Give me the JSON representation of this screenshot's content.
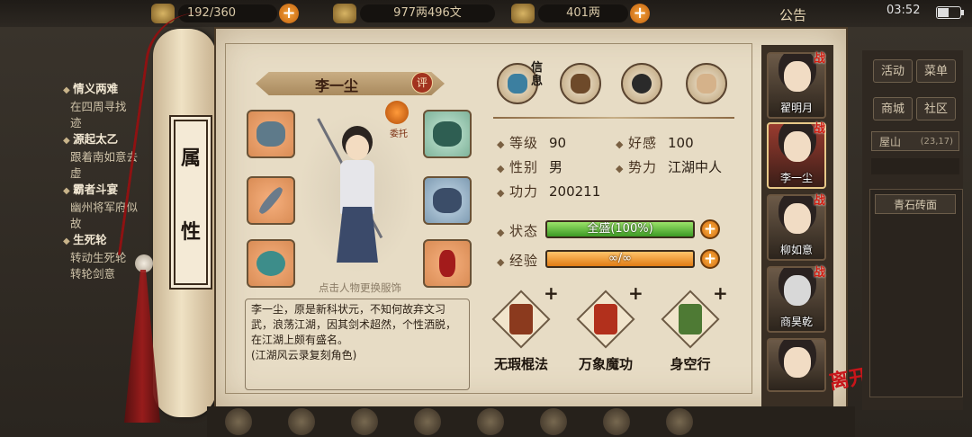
{
  "topbar": {
    "resource1": "192/360",
    "resource2": "977两496文",
    "resource3": "401两",
    "announcement": "公告",
    "time": "03:52"
  },
  "quests": [
    {
      "title": "情义两难",
      "desc": "在四周寻找\n迹"
    },
    {
      "title": "源起太乙",
      "desc": "跟着南如意去\n虚"
    },
    {
      "title": "霸者斗宴",
      "desc": "幽州将军府似\n故"
    },
    {
      "title": "生死轮",
      "desc": "转动生死轮\n转轮剑意"
    }
  ],
  "scroll_title": [
    "属",
    "性"
  ],
  "character": {
    "name": "李一尘",
    "rate_badge": "评",
    "delegate_label": "委托",
    "change_outfit_hint": "点击人物更换服饰",
    "description": "李一尘，原是新科状元，不知何故弃文习武，浪荡江湖，因其剑术超然，个性洒脱，在江湖上颇有盛名。\n(江湖风云录复刻角色)"
  },
  "info_label": "信息",
  "stats": {
    "level_label": "等级",
    "level": "90",
    "affection_label": "好感",
    "affection": "100",
    "gender_label": "性别",
    "gender": "男",
    "faction_label": "势力",
    "faction": "江湖中人",
    "power_label": "功力",
    "power": "200211"
  },
  "status": {
    "label": "状态",
    "text": "全盛(100%)",
    "fill_fraction": 1.0
  },
  "exp": {
    "label": "经验",
    "text": "∞/∞",
    "fill_fraction": 1.0
  },
  "skills": [
    {
      "name": "无瑕棍法"
    },
    {
      "name": "万象魔功"
    },
    {
      "name": "身空行"
    }
  ],
  "party": [
    {
      "name": "翟明月",
      "tag": "战"
    },
    {
      "name": "李一尘",
      "tag": "战"
    },
    {
      "name": "柳如意",
      "tag": "战"
    },
    {
      "name": "商昊乾",
      "tag": "战"
    },
    {
      "name": ""
    }
  ],
  "leave_label": "离开",
  "right_panel": {
    "buttons": [
      "活动",
      "菜单",
      "商城",
      "社区"
    ],
    "location": "屋山",
    "coords": "(23,17)",
    "list_item": "青石砖面"
  },
  "colors": {
    "accent_orange": "#e07c14",
    "accent_green": "#3c9a24",
    "parchment": "#e7dcc5",
    "battle_red": "#d21d10"
  }
}
